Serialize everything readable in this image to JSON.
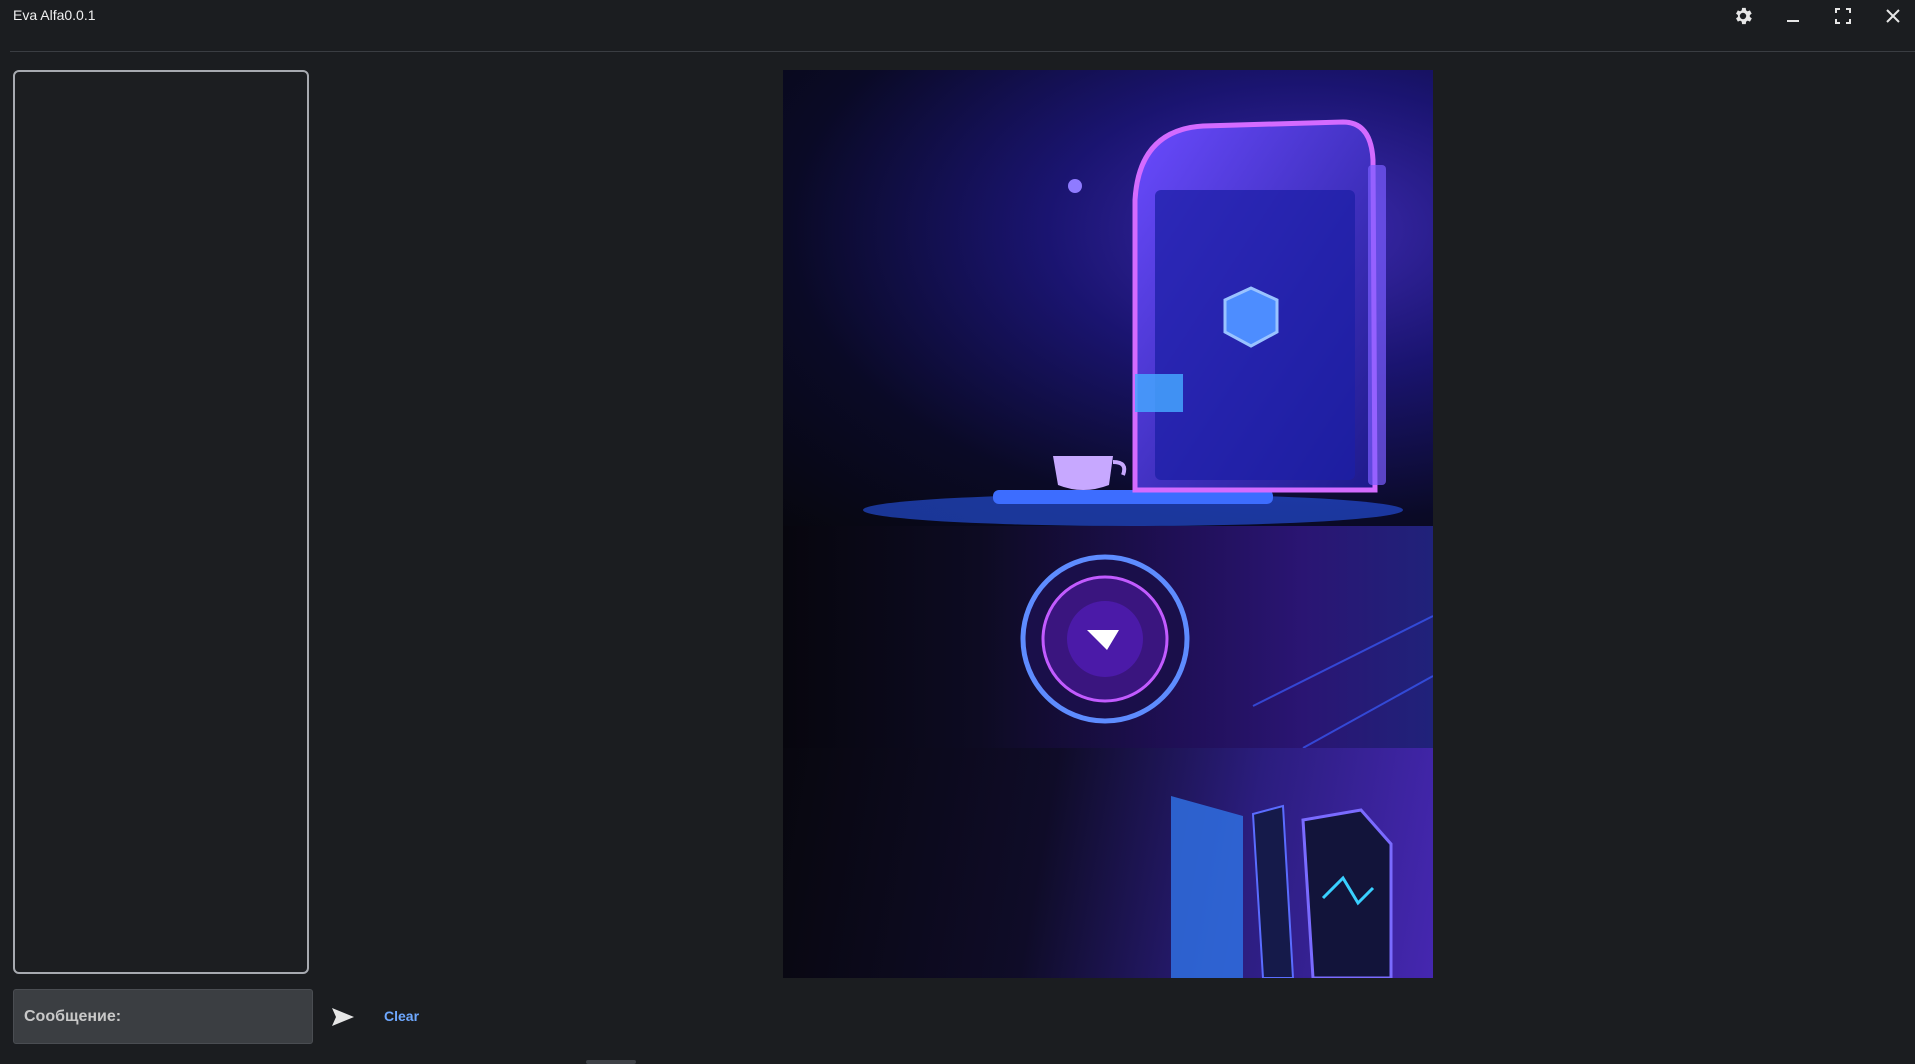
{
  "window": {
    "title": "Eva Alfa0.0.1"
  },
  "controls": {
    "settings_icon": "gear-icon",
    "minimize_icon": "minimize-icon",
    "maximize_icon": "maximize-icon",
    "close_icon": "close-icon"
  },
  "chat": {
    "input_placeholder": "Сообщение:",
    "input_value": "",
    "send_icon": "send-icon",
    "clear_label": "Clear"
  },
  "colors": {
    "background": "#1b1d20",
    "panel_border": "#a7aab0",
    "input_bg": "#3b3e42",
    "clear_link": "#6ea8ff"
  }
}
